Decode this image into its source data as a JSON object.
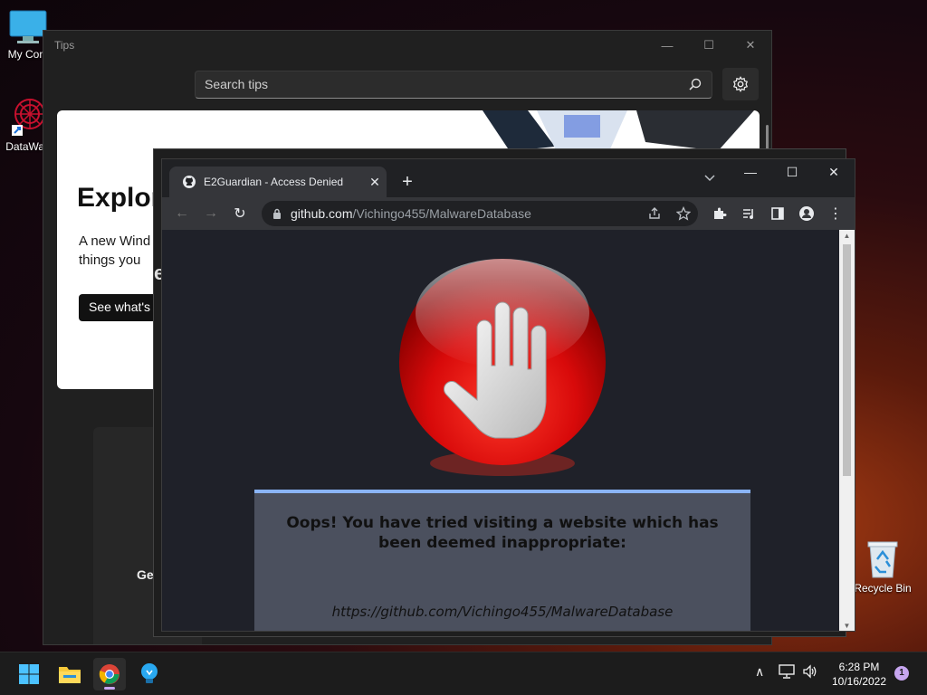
{
  "desktop": {
    "icons": [
      {
        "label": "My Com"
      },
      {
        "label": "DataWag"
      },
      {
        "label": "Recycle Bin"
      }
    ]
  },
  "tips": {
    "title": "Tips",
    "search_placeholder": "Search tips",
    "hero": {
      "title": "Explor",
      "description": "A new Wind things you",
      "button_label": "See what's n"
    },
    "card_text": "Ge"
  },
  "chrome": {
    "tab_title": "E2Guardian - Access Denied",
    "url_host": "github.com",
    "url_path": "/Vichingo455/MalwareDatabase",
    "page": {
      "message": "Oops! You have tried visiting a website which has been deemed inappropriate:",
      "blocked_url": "https://github.com/Vichingo455/MalwareDatabase"
    }
  },
  "taskbar": {
    "time": "6:28 PM",
    "date": "10/16/2022",
    "notification_count": "1"
  },
  "colors": {
    "accent": "#8ab4f8",
    "stop_red": "#e01010",
    "taskbar_indicator": "#c7a6f0"
  }
}
